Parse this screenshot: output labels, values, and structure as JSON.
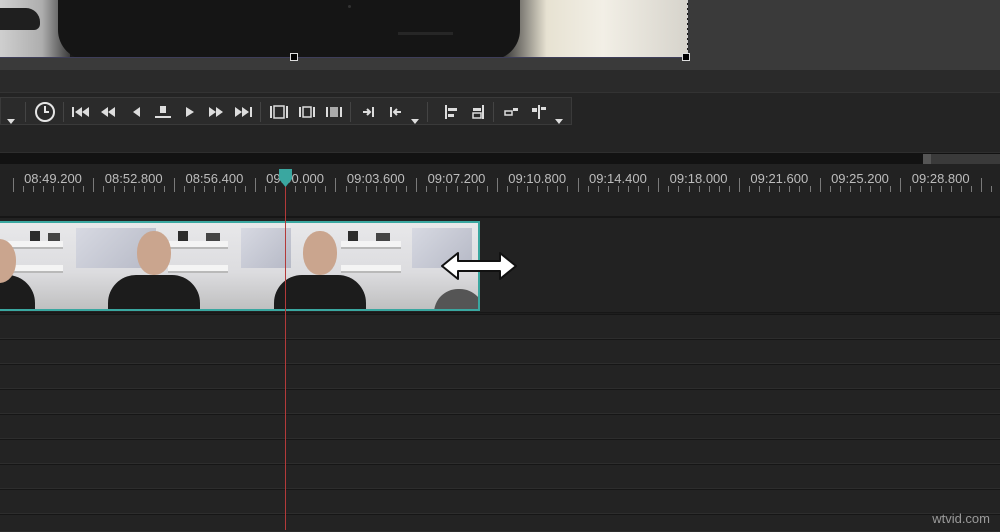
{
  "ruler": {
    "labels": [
      "08:49.200",
      "08:52.800",
      "08:56.400",
      "09:00.000",
      "09:03.600",
      "09:07.200",
      "09:10.800",
      "09:14.400",
      "09:18.000",
      "09:21.600",
      "09:25.200",
      "09:28.800"
    ]
  },
  "toolbar": {
    "buttons": [
      {
        "name": "snapshot-clock-icon"
      },
      {
        "name": "go-to-start-icon"
      },
      {
        "name": "rewind-icon"
      },
      {
        "name": "step-back-icon"
      },
      {
        "name": "stop-icon"
      },
      {
        "name": "play-icon"
      },
      {
        "name": "fast-forward-icon"
      },
      {
        "name": "go-to-end-icon"
      },
      {
        "name": "split-clip-icon"
      },
      {
        "name": "trim-start-icon"
      },
      {
        "name": "trim-end-icon"
      },
      {
        "name": "set-in-point-icon"
      },
      {
        "name": "set-out-point-icon"
      },
      {
        "name": "align-left-icon"
      },
      {
        "name": "align-right-icon"
      },
      {
        "name": "ripple-icon"
      },
      {
        "name": "marker-icon"
      }
    ]
  },
  "colors": {
    "playhead": "#3aa7a0",
    "clip_border": "#3aa7a0",
    "playhead_line": "#b33a3a"
  },
  "cursor": {
    "icon": "horizontal-resize-cursor-icon"
  },
  "watermark": {
    "text": "wtvid.com"
  }
}
